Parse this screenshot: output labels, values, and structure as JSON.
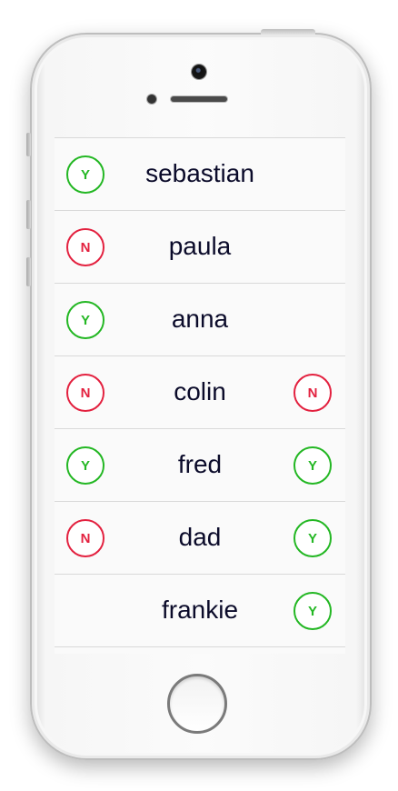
{
  "rows": [
    {
      "name": "sebastian",
      "left": "Y",
      "right": ""
    },
    {
      "name": "paula",
      "left": "N",
      "right": ""
    },
    {
      "name": "anna",
      "left": "Y",
      "right": ""
    },
    {
      "name": "colin",
      "left": "N",
      "right": "N"
    },
    {
      "name": "fred",
      "left": "Y",
      "right": "Y"
    },
    {
      "name": "dad",
      "left": "N",
      "right": "Y"
    },
    {
      "name": "frankie",
      "left": "",
      "right": "Y"
    }
  ],
  "colors": {
    "yes": "#23b723",
    "no": "#e3213f",
    "name_text": "#0b0b2a"
  }
}
